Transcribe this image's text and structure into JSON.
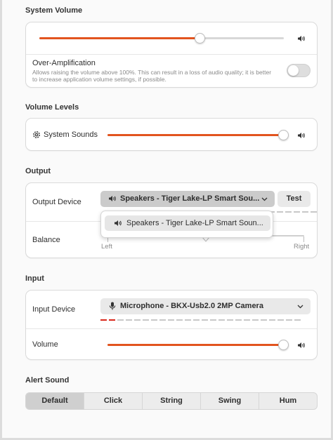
{
  "system_volume": {
    "title": "System Volume",
    "level": 0.67,
    "over_amplification": {
      "label": "Over-Amplification",
      "description_line1": "Allows raising the volume above 100%. This can result in a loss of audio quality; it is better",
      "description_line2": "to increase application volume settings, if possible.",
      "enabled": false
    }
  },
  "volume_levels": {
    "title": "Volume Levels",
    "system_sounds": {
      "label": "System Sounds",
      "level": 0.97
    }
  },
  "output": {
    "title": "Output",
    "device_label": "Output Device",
    "device_value": "Speakers - Tiger Lake-LP Smart Sou...",
    "test_label": "Test",
    "balance_label": "Balance",
    "balance_left": "Left",
    "balance_right": "Right",
    "balance_value": 0.5,
    "popover_option": "Speakers - Tiger Lake-LP Smart Soun..."
  },
  "input": {
    "title": "Input",
    "device_label": "Input Device",
    "device_value": "Microphone - BKX-Usb2.0 2MP Camera",
    "volume_label": "Volume",
    "volume_level": 0.97,
    "active_level_segments": 2
  },
  "alert_sound": {
    "title": "Alert Sound",
    "options": [
      "Default",
      "Click",
      "String",
      "Swing",
      "Hum"
    ],
    "selected": "Default"
  },
  "colors": {
    "accent": "#e2541f",
    "level_active": "#d9291c"
  }
}
